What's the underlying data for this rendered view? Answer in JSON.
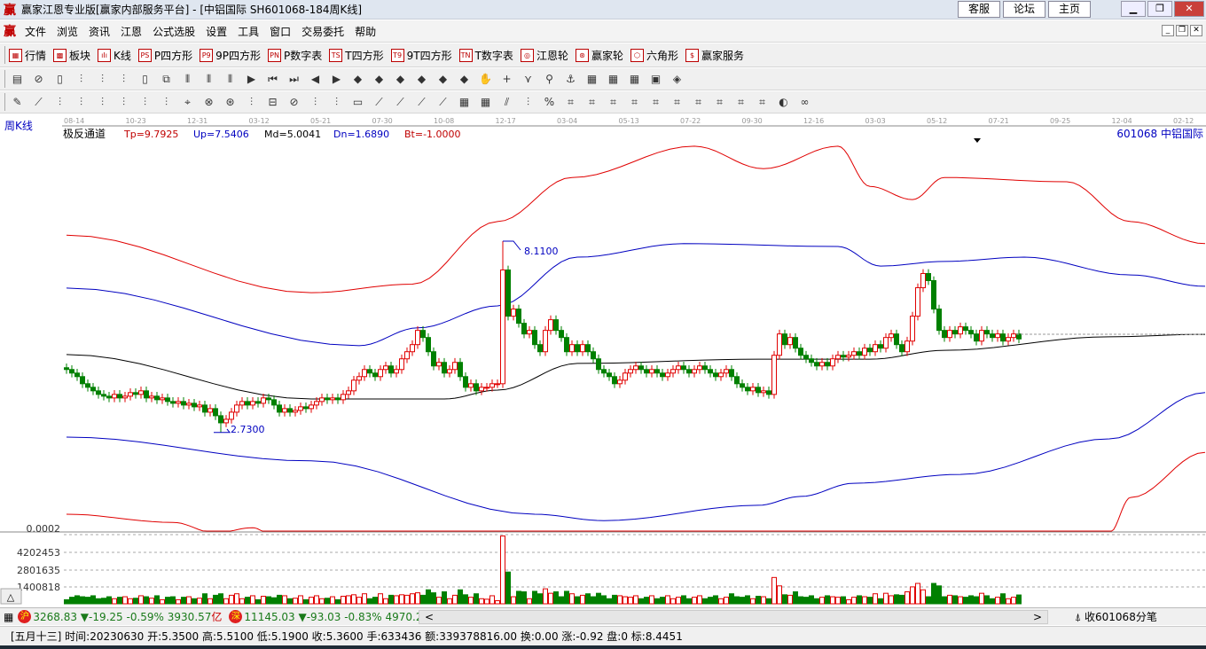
{
  "window": {
    "title": "赢家江恩专业版[赢家内部服务平台] - [中铝国际  SH601068-184周K线]",
    "logo": "赢",
    "links": [
      "客服",
      "论坛",
      "主页"
    ]
  },
  "menu": [
    "文件",
    "浏览",
    "资讯",
    "江恩",
    "公式选股",
    "设置",
    "工具",
    "窗口",
    "交易委托",
    "帮助"
  ],
  "toolbar1": [
    {
      "icon": "grid-icon",
      "glyph": "▦",
      "label": "行情"
    },
    {
      "icon": "blocks-icon",
      "glyph": "▩",
      "label": "板块"
    },
    {
      "icon": "candles-icon",
      "glyph": "ıIı",
      "label": "K线"
    },
    {
      "icon": "ps-icon",
      "glyph": "PS",
      "label": "P四方形"
    },
    {
      "icon": "p9-icon",
      "glyph": "P9",
      "label": "9P四方形"
    },
    {
      "icon": "pn-icon",
      "glyph": "PN",
      "label": "P数字表"
    },
    {
      "icon": "ts-icon",
      "glyph": "TS",
      "label": "T四方形"
    },
    {
      "icon": "t9-icon",
      "glyph": "T9",
      "label": "9T四方形"
    },
    {
      "icon": "tn-icon",
      "glyph": "TN",
      "label": "T数字表"
    },
    {
      "icon": "gann-wheel-icon",
      "glyph": "◎",
      "label": "江恩轮"
    },
    {
      "icon": "big-wheel-icon",
      "glyph": "⊛",
      "label": "赢家轮"
    },
    {
      "icon": "hexagon-icon",
      "glyph": "⬡",
      "label": "六角形"
    },
    {
      "icon": "dollar-icon",
      "glyph": "$",
      "label": "赢家服务"
    }
  ],
  "toolbar2": [
    "▤",
    "⊘",
    "▯",
    "⫶",
    "⫶",
    "⫶",
    "▯",
    "⧉",
    "⫴",
    "⫴",
    "⫴",
    "▶",
    "⏮",
    "⏭",
    "◀",
    "▶",
    "◆",
    "◆",
    "◆",
    "◆",
    "◆",
    "◆",
    "✋",
    "+",
    "⋎",
    "⚲",
    "⚓",
    "▦",
    "▦",
    "▦",
    "▣",
    "◈"
  ],
  "toolbar3": [
    "✎",
    "⟋",
    "⫶",
    "⫶",
    "⫶",
    "⫶",
    "⫶",
    "⫶",
    "⌖",
    "⊗",
    "⊛",
    "⫶",
    "⊟",
    "⊘",
    "⫶",
    "⫶",
    "▭",
    "⟋",
    "⟋",
    "⟋",
    "⟋",
    "▦",
    "▦",
    "⫽",
    "⫶",
    "%",
    "⌗",
    "⌗",
    "⌗",
    "⌗",
    "⌗",
    "⌗",
    "⌗",
    "⌗",
    "⌗",
    "⌗",
    "◐",
    "∞"
  ],
  "chart": {
    "period_label": "周K线",
    "indicator": {
      "name": "极反通道",
      "tp": "Tp=9.7925",
      "up": "Up=7.5406",
      "md": "Md=5.0041",
      "dn": "Dn=1.6890",
      "bt": "Bt=-1.0000"
    },
    "stock": "601068  中铝国际",
    "dates": [
      "08-14",
      "10-23",
      "12-31",
      "03-12",
      "05-21",
      "07-30",
      "10-08",
      "12-17",
      "03-04",
      "05-13",
      "07-22",
      "09-30",
      "12-16",
      "03-03",
      "05-12",
      "07-21",
      "09-25",
      "12-04",
      "02-12"
    ],
    "high_label": "8.1100",
    "low_label": "2.7300",
    "vol_axis": [
      "0.0002",
      "4202453",
      "2801635",
      "1400818"
    ],
    "colors": {
      "up": "#e00000",
      "down": "#008000",
      "band_outer": "#e00000",
      "band_inner": "#0000c0",
      "mid": "#000000"
    }
  },
  "chart_data": {
    "type": "candlestick",
    "closes": [
      4.5,
      4.4,
      4.3,
      4.1,
      4.0,
      3.9,
      3.8,
      3.75,
      3.7,
      3.8,
      3.7,
      3.75,
      3.85,
      3.8,
      3.9,
      3.7,
      3.75,
      3.65,
      3.7,
      3.6,
      3.55,
      3.6,
      3.5,
      3.55,
      3.45,
      3.5,
      3.3,
      3.4,
      3.2,
      3.0,
      3.1,
      3.3,
      3.5,
      3.6,
      3.5,
      3.6,
      3.55,
      3.7,
      3.65,
      3.5,
      3.3,
      3.4,
      3.3,
      3.35,
      3.45,
      3.4,
      3.5,
      3.6,
      3.7,
      3.65,
      3.7,
      3.65,
      3.8,
      3.9,
      4.2,
      4.3,
      4.5,
      4.4,
      4.3,
      4.5,
      4.6,
      4.4,
      4.5,
      4.8,
      5.0,
      5.2,
      5.6,
      5.4,
      5.0,
      4.6,
      4.7,
      4.4,
      4.5,
      4.7,
      4.3,
      4.0,
      4.1,
      3.9,
      4.0,
      4.0,
      4.1,
      4.1,
      7.3,
      6.0,
      6.2,
      5.8,
      5.5,
      5.6,
      5.2,
      5.0,
      5.6,
      5.9,
      5.6,
      5.4,
      5.0,
      5.2,
      5.0,
      5.2,
      5.0,
      4.8,
      4.5,
      4.4,
      4.3,
      4.1,
      4.2,
      4.4,
      4.5,
      4.6,
      4.5,
      4.4,
      4.5,
      4.4,
      4.3,
      4.4,
      4.5,
      4.6,
      4.5,
      4.4,
      4.5,
      4.6,
      4.5,
      4.4,
      4.3,
      4.4,
      4.5,
      4.3,
      4.1,
      4.0,
      3.9,
      4.0,
      3.85,
      3.9,
      3.8,
      4.9,
      5.5,
      5.2,
      5.4,
      5.1,
      4.9,
      4.8,
      4.7,
      4.6,
      4.7,
      4.6,
      4.8,
      4.9,
      4.85,
      4.9,
      5.0,
      4.9,
      5.1,
      5.0,
      5.2,
      5.1,
      5.4,
      5.5,
      5.2,
      5.0,
      5.3,
      6.0,
      6.8,
      7.2,
      7.0,
      6.2,
      5.6,
      5.4,
      5.6,
      5.5,
      5.7,
      5.6,
      5.5,
      5.3,
      5.6,
      5.5,
      5.4,
      5.5,
      5.3,
      5.4,
      5.5,
      5.36
    ],
    "bands": {
      "top": [
        [
          0,
          8.28
        ],
        [
          46,
          6.66
        ],
        [
          65,
          6.9
        ],
        [
          81,
          8.66
        ],
        [
          95,
          9.9
        ],
        [
          118,
          10.78
        ],
        [
          131,
          10.15
        ],
        [
          145,
          10.78
        ],
        [
          151,
          9.65
        ],
        [
          159,
          9.28
        ],
        [
          165,
          9.9
        ],
        [
          188,
          9.78
        ],
        [
          200,
          8.66
        ],
        [
          214,
          8.04
        ]
      ],
      "up": [
        [
          0,
          6.79
        ],
        [
          55,
          5.17
        ],
        [
          66,
          5.67
        ],
        [
          81,
          6.29
        ],
        [
          96,
          7.66
        ],
        [
          116,
          8.04
        ],
        [
          145,
          7.96
        ],
        [
          153,
          7.41
        ],
        [
          165,
          7.54
        ],
        [
          180,
          7.66
        ],
        [
          200,
          7.16
        ],
        [
          214,
          6.84
        ]
      ],
      "md": [
        [
          0,
          4.92
        ],
        [
          46,
          3.67
        ],
        [
          71,
          3.67
        ],
        [
          81,
          3.92
        ],
        [
          96,
          4.67
        ],
        [
          130,
          4.79
        ],
        [
          151,
          4.79
        ],
        [
          165,
          5.04
        ],
        [
          196,
          5.42
        ],
        [
          214,
          5.49
        ]
      ],
      "dn": [
        [
          0,
          2.6
        ],
        [
          46,
          1.93
        ],
        [
          88,
          0.43
        ],
        [
          101,
          0.25
        ],
        [
          130,
          0.68
        ],
        [
          138,
          0.93
        ],
        [
          148,
          1.3
        ],
        [
          168,
          1.55
        ],
        [
          196,
          2.55
        ],
        [
          214,
          3.85
        ]
      ],
      "bottom": [
        [
          0,
          0.43
        ],
        [
          20,
          0.2
        ],
        [
          28,
          -0.1
        ],
        [
          35,
          0.05
        ],
        [
          38,
          -0.1
        ],
        [
          196,
          -0.1
        ],
        [
          200,
          0.9
        ],
        [
          214,
          2.17
        ]
      ]
    },
    "high": 8.11,
    "low": 2.73
  },
  "index_bar": {
    "sh_badge": "沪",
    "sh": "3268.83 ▼-19.25 -0.59% 3930.57",
    "yi": "亿",
    "sz_badge": "深",
    "sz": "11145.03 ▼-93.03 -0.83% 4970.20",
    "scroll_left": "<",
    "scroll_right": ">",
    "collect": "收601068分笔"
  },
  "status": "[五月十三] 时间:20230630 开:5.3500 高:5.5100 低:5.1900 收:5.3600 手:633436 额:339378816.00 换:0.00 涨:-0.92 盘:0 标:8.4451"
}
